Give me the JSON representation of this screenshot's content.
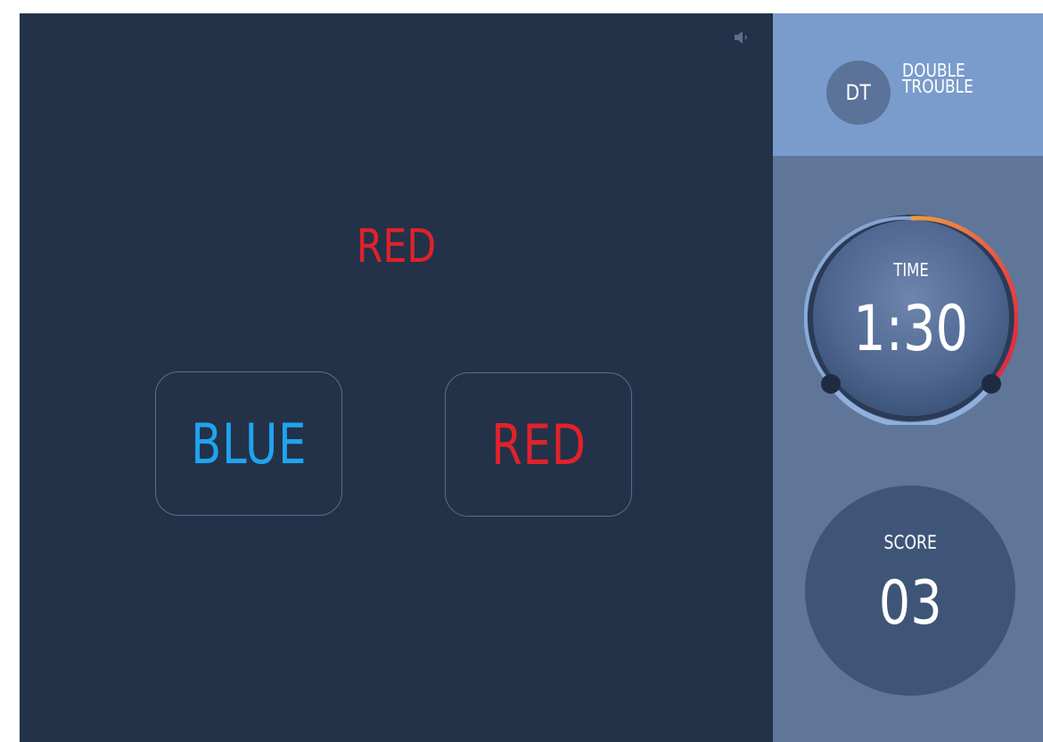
{
  "game": {
    "prompt_word": "RED",
    "prompt_color": "#e0222b",
    "choices": [
      {
        "label": "BLUE",
        "color": "#1fa3f0"
      },
      {
        "label": "RED",
        "color": "#e0222b"
      }
    ],
    "sound_icon": "speaker-icon"
  },
  "brand": {
    "badge": "DT",
    "name_line1": "DOUBLE",
    "name_line2": "TROUBLE"
  },
  "timer": {
    "label": "TIME",
    "value": "1:30"
  },
  "score": {
    "label": "SCORE",
    "value": "03"
  },
  "colors": {
    "game_bg": "#233248",
    "panel_bg": "#5f7699",
    "brand_bg": "#7a9ccc",
    "timer_arc_start": "#f08a3c",
    "timer_arc_end": "#e0223a"
  }
}
